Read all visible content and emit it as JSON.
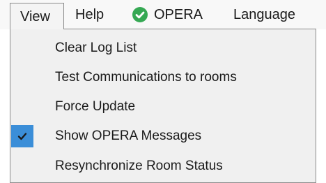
{
  "menubar": {
    "view": "View",
    "help": "Help",
    "opera": {
      "label": "OPERA",
      "status_icon": "green-check-circle-icon",
      "status_color": "#35a853"
    },
    "language": "Language"
  },
  "view_menu": {
    "items": [
      {
        "label": "Clear Log List",
        "checked": false
      },
      {
        "label": "Test Communications to rooms",
        "checked": false
      },
      {
        "label": "Force Update",
        "checked": false
      },
      {
        "label": "Show OPERA Messages",
        "checked": true
      },
      {
        "label": "Resynchronize Room Status",
        "checked": false
      }
    ],
    "check_highlight_color": "#3b8ed8"
  }
}
